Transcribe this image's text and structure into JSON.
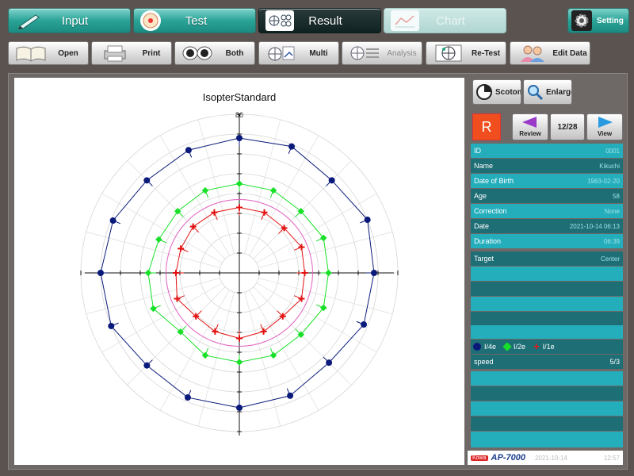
{
  "top_tabs": [
    {
      "label": "Input",
      "icon": "pen-icon",
      "state": "normal"
    },
    {
      "label": "Test",
      "icon": "target-icon",
      "state": "normal"
    },
    {
      "label": "Result",
      "icon": "grid-icon",
      "state": "active"
    },
    {
      "label": "Chart",
      "icon": "chart-icon",
      "state": "disabled"
    }
  ],
  "setting_label": "Setting",
  "toolbar": [
    {
      "label": "Open",
      "icon": "book-icon",
      "state": "normal"
    },
    {
      "label": "Print",
      "icon": "printer-icon",
      "state": "normal"
    },
    {
      "label": "Both",
      "icon": "eyes-icon",
      "state": "normal"
    },
    {
      "label": "Multi",
      "icon": "multi-icon",
      "state": "normal"
    },
    {
      "label": "Analysis",
      "icon": "analysis-icon",
      "state": "disabled"
    },
    {
      "label": "Re-Test",
      "icon": "retest-icon",
      "state": "normal"
    },
    {
      "label": "Edit Data",
      "icon": "people-icon",
      "state": "normal"
    }
  ],
  "side": {
    "scotoma_label": "Scotoma",
    "enlarge_label": "Enlarge",
    "eye": "R",
    "review_label": "Review",
    "page": "12/28",
    "view_label": "View"
  },
  "info": [
    {
      "label": "ID",
      "value": "0001"
    },
    {
      "label": "Name",
      "value": "Kikuchi"
    },
    {
      "label": "Date of Birth",
      "value": "1963-02-20"
    },
    {
      "label": "Age",
      "value": "58"
    },
    {
      "label": "Correction",
      "value": "None"
    },
    {
      "label": "Date",
      "value": "2021-10-14 06:13"
    },
    {
      "label": "Duration",
      "value": "06:39"
    },
    {
      "label": "Target",
      "value": "Center"
    }
  ],
  "speed": {
    "label": "speed",
    "value": "5/3"
  },
  "footer": {
    "brand": "Kowa",
    "model": "AP-7000",
    "date": "2021-10-14",
    "time": "12:57"
  },
  "colors": {
    "i4e": "#0a1a7a",
    "i2e": "#18e028",
    "i1e": "#e41010",
    "blind_spot": "#e060c0",
    "teal": "#24aebc",
    "dark_teal": "#1e6e76"
  },
  "chart_data": {
    "type": "polar-isopter",
    "title": "IsopterStandard",
    "radial_label": "80",
    "rmax": 80,
    "series": [
      {
        "name": "I/4e",
        "marker": "circle",
        "points": [
          [
            0,
            68
          ],
          [
            22.5,
            70
          ],
          [
            45,
            66
          ],
          [
            67.5,
            69
          ],
          [
            90,
            68
          ],
          [
            112.5,
            67
          ],
          [
            135,
            66
          ],
          [
            157.5,
            69
          ],
          [
            180,
            70
          ],
          [
            202.5,
            70
          ],
          [
            225,
            66
          ],
          [
            247.5,
            68
          ],
          [
            270,
            68
          ],
          [
            292.5,
            67
          ],
          [
            315,
            64
          ],
          [
            337.5,
            68
          ]
        ]
      },
      {
        "name": "I/2e",
        "marker": "diamond",
        "points": [
          [
            0,
            45
          ],
          [
            22.5,
            46
          ],
          [
            45,
            44
          ],
          [
            67.5,
            45
          ],
          [
            90,
            45
          ],
          [
            112.5,
            45
          ],
          [
            135,
            44
          ],
          [
            157.5,
            44
          ],
          [
            180,
            46
          ],
          [
            202.5,
            47
          ],
          [
            225,
            42
          ],
          [
            247.5,
            45
          ],
          [
            270,
            45
          ],
          [
            292.5,
            45
          ],
          [
            315,
            44
          ],
          [
            337.5,
            46
          ]
        ]
      },
      {
        "name": "I/1e",
        "marker": "cross",
        "points": [
          [
            0,
            33
          ],
          [
            22.5,
            34
          ],
          [
            45,
            32
          ],
          [
            67.5,
            33
          ],
          [
            90,
            33
          ],
          [
            112.5,
            33
          ],
          [
            135,
            33
          ],
          [
            157.5,
            32
          ],
          [
            180,
            32
          ],
          [
            202.5,
            34
          ],
          [
            225,
            31
          ],
          [
            247.5,
            32
          ],
          [
            270,
            33
          ],
          [
            292.5,
            32
          ],
          [
            315,
            31
          ],
          [
            337.5,
            34
          ]
        ]
      }
    ],
    "blind_spot_ring": 37
  }
}
